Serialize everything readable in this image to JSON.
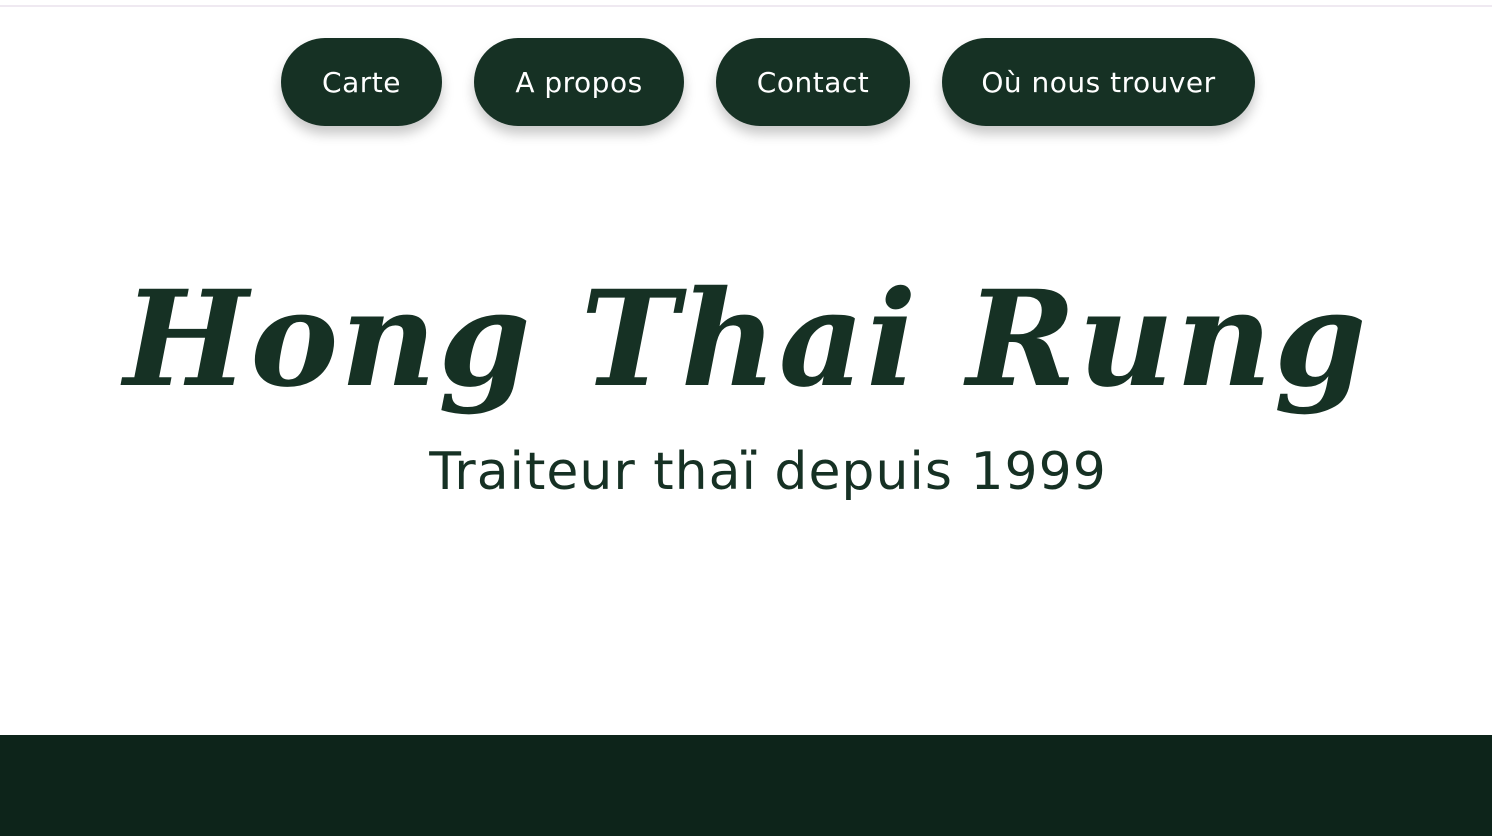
{
  "nav": {
    "items": [
      {
        "label": "Carte"
      },
      {
        "label": "A propos"
      },
      {
        "label": "Contact"
      },
      {
        "label": "Où nous trouver"
      }
    ]
  },
  "hero": {
    "title": "Hong Thai Rung",
    "subtitle": "Traiteur thaï depuis 1999"
  },
  "colors": {
    "brand_green": "#163124",
    "footer_green": "#0d241a",
    "background": "#ffffff",
    "button_text": "#ffffff"
  }
}
